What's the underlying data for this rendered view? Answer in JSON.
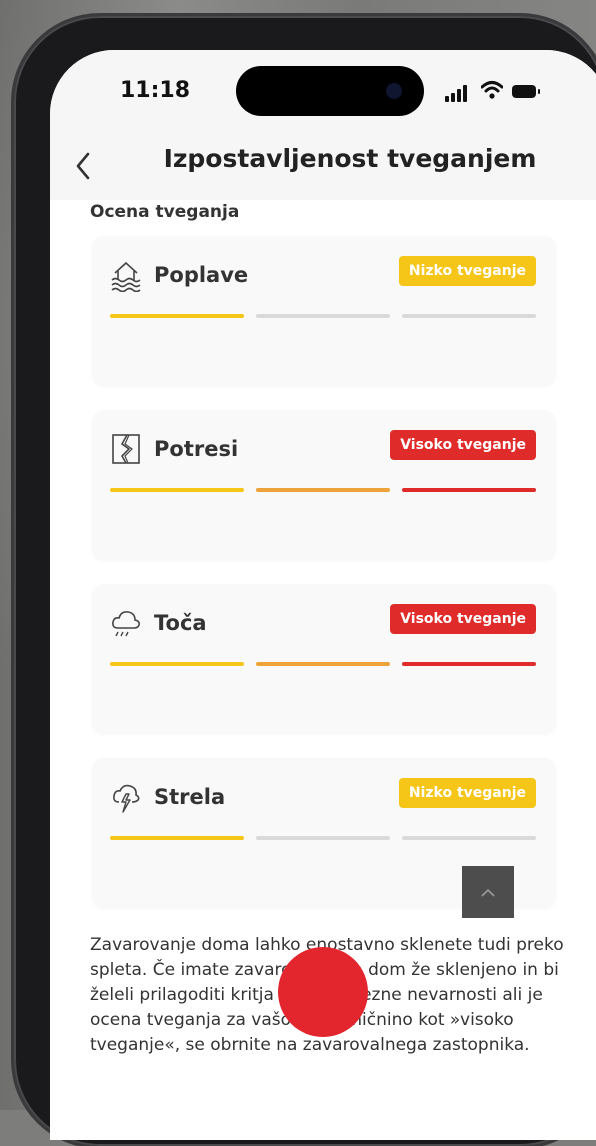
{
  "status_bar": {
    "time": "11:18"
  },
  "header": {
    "back_icon": "chevron-left-icon",
    "title": "Izpostavljenost tveganjem"
  },
  "section": {
    "title": "Ocena tveganja"
  },
  "colors": {
    "yellow": "#f5c518",
    "orange": "#eea33a",
    "red": "#e02b2b",
    "empty": "#dadada"
  },
  "risks": [
    {
      "name": "Poplave",
      "icon": "flood-house-icon",
      "badge": "Nizko tveganje",
      "level": "low",
      "segments_filled": 1
    },
    {
      "name": "Potresi",
      "icon": "earthquake-icon",
      "badge": "Visoko tveganje",
      "level": "high",
      "segments_filled": 3
    },
    {
      "name": "Toča",
      "icon": "hail-cloud-icon",
      "badge": "Visoko tveganje",
      "level": "high",
      "segments_filled": 3
    },
    {
      "name": "Strela",
      "icon": "lightning-cloud-icon",
      "badge": "Nizko tveganje",
      "level": "low",
      "segments_filled": 1
    }
  ],
  "info": {
    "text": "Zavarovanje doma lahko enostavno sklenete tudi preko spleta. Če imate zavarovanje za dom že sklenjeno in bi želeli prilagoditi kritja za posamezne nevarnosti ali je ocena tveganja za vašo nepremičnino kot »visoko tveganje«, se obrnite na zavarovalnega zastopnika."
  },
  "controls": {
    "scroll_top_icon": "chevron-up-icon"
  }
}
